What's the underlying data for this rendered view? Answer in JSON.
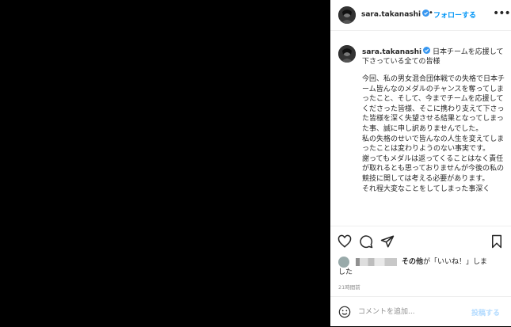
{
  "header": {
    "username": "sara.takanashi",
    "dot": "•",
    "follow_label": "フォローする",
    "more": "•••"
  },
  "caption": {
    "username": "sara.takanashi",
    "headline": "日本チームを応援して下さっている全ての皆様",
    "body": "今回、私の男女混合団体戦での失格で日本チーム皆んなのメダルのチャンスを奪ってしまったこと、そして、今までチームを応援してくださった皆様、そこに携わり支えて下さった皆様を深く失望させる結果となってしまった事、誠に申し訳ありませんでした。\n私の失格のせいで皆んなの人生を変えてしまったことは変わりようのない事実です。\n謝ってもメダルは返ってくることはなく責任が取れるとも思っておりませんが今後の私の競技に関しては考える必要があります。\nそれ程大変なことをしてしまった事深く"
  },
  "likes": {
    "others": "その他",
    "text_a": "が「いいね！」しま",
    "text_b": "した"
  },
  "timestamp": "21時間前",
  "comment": {
    "placeholder": "コメントを追加...",
    "post_label": "投稿する"
  },
  "colors": {
    "accent": "#0095f6",
    "verified": "#3897f0",
    "post_disabled": "#b3dbff"
  }
}
